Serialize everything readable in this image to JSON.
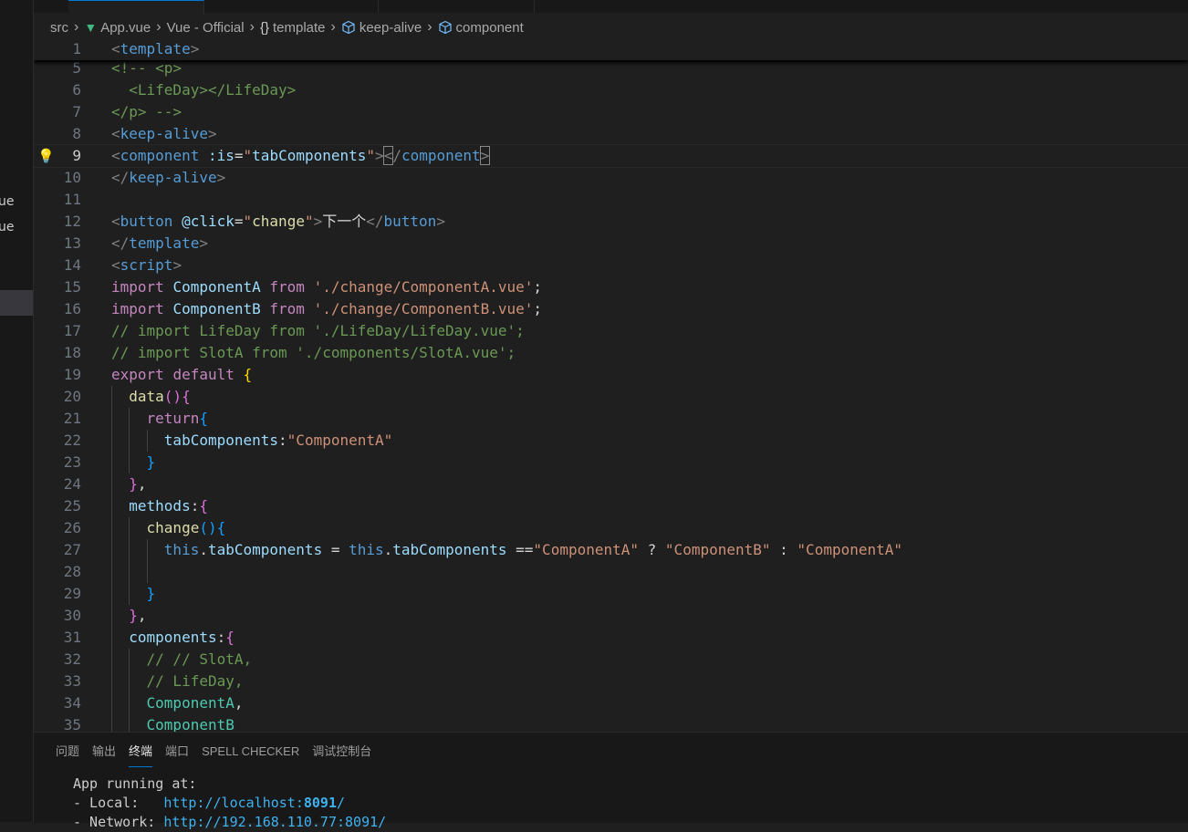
{
  "breadcrumb": {
    "items": [
      {
        "label": "src",
        "icon": ""
      },
      {
        "label": "App.vue",
        "icon": "vue-logo-icon"
      },
      {
        "label": "Vue - Official",
        "icon": ""
      },
      {
        "label": "template",
        "icon": "braces-icon"
      },
      {
        "label": "keep-alive",
        "icon": "cube-icon"
      },
      {
        "label": "component",
        "icon": "cube-icon"
      }
    ]
  },
  "sidebar": {
    "fragments": [
      "ue",
      "ue"
    ]
  },
  "editor": {
    "current_line": 9,
    "lines": [
      {
        "n": "1",
        "tokens": [
          [
            "t-br",
            "<"
          ],
          [
            "t-tag",
            "template"
          ],
          [
            "t-br",
            ">"
          ]
        ]
      },
      {
        "n": "5",
        "tokens": [
          [
            "t-cm",
            "<!-- <p>"
          ]
        ]
      },
      {
        "n": "6",
        "tokens": [
          [
            "t-cm",
            "  <LifeDay></LifeDay>"
          ]
        ]
      },
      {
        "n": "7",
        "tokens": [
          [
            "t-cm",
            "</p> -->"
          ]
        ]
      },
      {
        "n": "8",
        "tokens": [
          [
            "t-br",
            "<"
          ],
          [
            "t-tag",
            "keep-alive"
          ],
          [
            "t-br",
            ">"
          ]
        ]
      },
      {
        "n": "9",
        "tokens": [
          [
            "t-br",
            "<"
          ],
          [
            "t-tag",
            "component"
          ],
          [
            "t-txt",
            " "
          ],
          [
            "t-attr",
            ":is"
          ],
          [
            "t-txt",
            "="
          ],
          [
            "t-str",
            "\""
          ],
          [
            "t-var",
            "tabComponents"
          ],
          [
            "t-str",
            "\""
          ],
          [
            "t-br",
            ">"
          ],
          [
            "t-br match",
            "<"
          ],
          [
            "t-br",
            "/"
          ],
          [
            "t-tag",
            "component"
          ],
          [
            "t-br match",
            ">"
          ]
        ]
      },
      {
        "n": "10",
        "tokens": [
          [
            "t-br",
            "</"
          ],
          [
            "t-tag",
            "keep-alive"
          ],
          [
            "t-br",
            ">"
          ]
        ]
      },
      {
        "n": "11",
        "tokens": []
      },
      {
        "n": "12",
        "tokens": [
          [
            "t-br",
            "<"
          ],
          [
            "t-tag",
            "button"
          ],
          [
            "t-txt",
            " "
          ],
          [
            "t-attr",
            "@click"
          ],
          [
            "t-txt",
            "="
          ],
          [
            "t-str",
            "\""
          ],
          [
            "t-fn",
            "change"
          ],
          [
            "t-str",
            "\""
          ],
          [
            "t-br",
            ">"
          ],
          [
            "t-txt",
            "下一个"
          ],
          [
            "t-br",
            "</"
          ],
          [
            "t-tag",
            "button"
          ],
          [
            "t-br",
            ">"
          ]
        ]
      },
      {
        "n": "13",
        "tokens": [
          [
            "t-br",
            "</"
          ],
          [
            "t-tag",
            "template"
          ],
          [
            "t-br",
            ">"
          ]
        ]
      },
      {
        "n": "14",
        "tokens": [
          [
            "t-br",
            "<"
          ],
          [
            "t-tag",
            "script"
          ],
          [
            "t-br",
            ">"
          ]
        ]
      },
      {
        "n": "15",
        "tokens": [
          [
            "t-kw",
            "import"
          ],
          [
            "t-txt",
            " "
          ],
          [
            "t-var",
            "ComponentA"
          ],
          [
            "t-txt",
            " "
          ],
          [
            "t-kw",
            "from"
          ],
          [
            "t-txt",
            " "
          ],
          [
            "t-str",
            "'./change/ComponentA.vue'"
          ],
          [
            "t-txt",
            ";"
          ]
        ]
      },
      {
        "n": "16",
        "tokens": [
          [
            "t-kw",
            "import"
          ],
          [
            "t-txt",
            " "
          ],
          [
            "t-var",
            "ComponentB"
          ],
          [
            "t-txt",
            " "
          ],
          [
            "t-kw",
            "from"
          ],
          [
            "t-txt",
            " "
          ],
          [
            "t-str",
            "'./change/ComponentB.vue'"
          ],
          [
            "t-txt",
            ";"
          ]
        ]
      },
      {
        "n": "17",
        "tokens": [
          [
            "t-cm",
            "// import LifeDay from './LifeDay/LifeDay.vue';"
          ]
        ]
      },
      {
        "n": "18",
        "tokens": [
          [
            "t-cm",
            "// import SlotA from './components/SlotA.vue';"
          ]
        ]
      },
      {
        "n": "19",
        "tokens": [
          [
            "t-kw",
            "export"
          ],
          [
            "t-txt",
            " "
          ],
          [
            "t-kw",
            "default"
          ],
          [
            "t-txt",
            " "
          ],
          [
            "t-b1",
            "{"
          ]
        ]
      },
      {
        "n": "20",
        "tokens": [
          [
            "t-txt",
            "  "
          ],
          [
            "t-fn",
            "data"
          ],
          [
            "t-b2",
            "()"
          ],
          [
            "t-b2",
            "{"
          ]
        ]
      },
      {
        "n": "21",
        "tokens": [
          [
            "t-txt",
            "    "
          ],
          [
            "t-kw",
            "return"
          ],
          [
            "t-b3",
            "{"
          ]
        ]
      },
      {
        "n": "22",
        "tokens": [
          [
            "t-txt",
            "      "
          ],
          [
            "t-var",
            "tabComponents"
          ],
          [
            "t-txt",
            ":"
          ],
          [
            "t-str",
            "\"ComponentA\""
          ]
        ]
      },
      {
        "n": "23",
        "tokens": [
          [
            "t-txt",
            "    "
          ],
          [
            "t-b3",
            "}"
          ]
        ]
      },
      {
        "n": "24",
        "tokens": [
          [
            "t-txt",
            "  "
          ],
          [
            "t-b2",
            "}"
          ],
          [
            "t-txt",
            ","
          ]
        ]
      },
      {
        "n": "25",
        "tokens": [
          [
            "t-txt",
            "  "
          ],
          [
            "t-var",
            "methods"
          ],
          [
            "t-txt",
            ":"
          ],
          [
            "t-b2",
            "{"
          ]
        ]
      },
      {
        "n": "26",
        "tokens": [
          [
            "t-txt",
            "    "
          ],
          [
            "t-fn",
            "change"
          ],
          [
            "t-b3",
            "()"
          ],
          [
            "t-b3",
            "{"
          ]
        ]
      },
      {
        "n": "27",
        "tokens": [
          [
            "t-txt",
            "      "
          ],
          [
            "t-blue",
            "this"
          ],
          [
            "t-txt",
            "."
          ],
          [
            "t-var",
            "tabComponents"
          ],
          [
            "t-txt",
            " = "
          ],
          [
            "t-blue",
            "this"
          ],
          [
            "t-txt",
            "."
          ],
          [
            "t-var",
            "tabComponents"
          ],
          [
            "t-txt",
            " =="
          ],
          [
            "t-str",
            "\"ComponentA\""
          ],
          [
            "t-txt",
            " ? "
          ],
          [
            "t-str",
            "\"ComponentB\""
          ],
          [
            "t-txt",
            " : "
          ],
          [
            "t-str",
            "\"ComponentA\""
          ]
        ]
      },
      {
        "n": "28",
        "tokens": []
      },
      {
        "n": "29",
        "tokens": [
          [
            "t-txt",
            "    "
          ],
          [
            "t-b3",
            "}"
          ]
        ]
      },
      {
        "n": "30",
        "tokens": [
          [
            "t-txt",
            "  "
          ],
          [
            "t-b2",
            "}"
          ],
          [
            "t-txt",
            ","
          ]
        ]
      },
      {
        "n": "31",
        "tokens": [
          [
            "t-txt",
            "  "
          ],
          [
            "t-var",
            "components"
          ],
          [
            "t-txt",
            ":"
          ],
          [
            "t-b2",
            "{"
          ]
        ]
      },
      {
        "n": "32",
        "tokens": [
          [
            "t-txt",
            "    "
          ],
          [
            "t-cm",
            "// // SlotA,"
          ]
        ]
      },
      {
        "n": "33",
        "tokens": [
          [
            "t-txt",
            "    "
          ],
          [
            "t-cm",
            "// LifeDay,"
          ]
        ]
      },
      {
        "n": "34",
        "tokens": [
          [
            "t-txt",
            "    "
          ],
          [
            "t-cls",
            "ComponentA"
          ],
          [
            "t-txt",
            ","
          ]
        ]
      },
      {
        "n": "35",
        "tokens": [
          [
            "t-txt",
            "    "
          ],
          [
            "t-cls",
            "ComponentB"
          ]
        ]
      }
    ]
  },
  "panel": {
    "tabs": [
      {
        "label": "问题",
        "active": false
      },
      {
        "label": "输出",
        "active": false
      },
      {
        "label": "终端",
        "active": true
      },
      {
        "label": "端口",
        "active": false
      },
      {
        "label": "SPELL CHECKER",
        "active": false
      },
      {
        "label": "调试控制台",
        "active": false
      }
    ],
    "terminal": {
      "line1": "App running at:",
      "local_label": "- Local:   ",
      "local_url_prefix": "http://localhost:",
      "local_port": "8091",
      "local_url_suffix": "/",
      "network_label": "- Network: ",
      "network_url": "http://192.168.110.77:8091/"
    }
  }
}
